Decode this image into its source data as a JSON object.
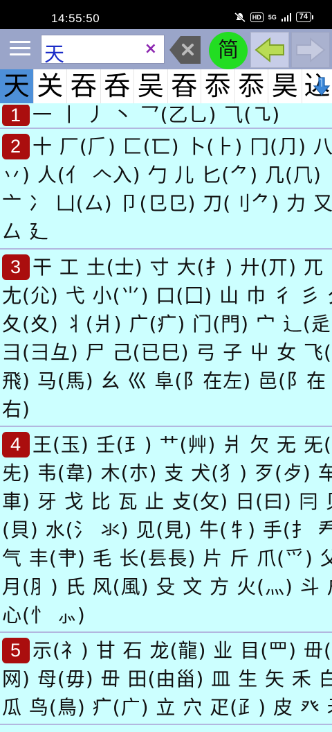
{
  "status_bar": {
    "time": "14:55:50",
    "hd": "HD",
    "network": "5G",
    "battery": "74"
  },
  "toolbar": {
    "search_value": "天",
    "clear_label": "×",
    "simplified_label": "简"
  },
  "candidates": {
    "items": [
      "天",
      "关",
      "吞",
      "呑",
      "吴",
      "昋",
      "忝",
      "忝",
      "昊"
    ],
    "partial": "込"
  },
  "sections": [
    {
      "number": "1",
      "lines": [
        "一 丨 丿 丶 乛(乙乚) ⺄(㇈)"
      ]
    },
    {
      "number": "2",
      "lines": [
        "十 厂(𠂆) 匚(匸) 卜(⺊) 冂(⺆) 八(",
        "丷) 人(亻 𠆢入) 勹 儿 匕(⺈) 几(⺇)",
        "亠 冫 凵(厶) 卩(⺋㔾) 刀(刂⺈) 力 又",
        "厶 廴"
      ]
    },
    {
      "number": "3",
      "lines": [
        "干 工 土(士) 寸 大(⺘) 廾(丌) 兀",
        "尢(尣) 弋 小(⺌) 口(囗) 山 巾 彳 彡 夕",
        "夂(夊) 丬(爿) 广(疒) 门(門) 宀 辶(辵)",
        "彐(⺕彑) 尸 己(已巳) 弓 子 屮 女 飞(",
        "飛) 马(馬) 幺 巛 阜(阝在左) 邑(阝在",
        "右)"
      ]
    },
    {
      "number": "4",
      "lines": [
        "王(玉) 壬(⺩) 艹(艸) 爿 欠 无 旡(",
        "兂) 韦(韋) 木(朩) 支 犬(犭) 歹(歺) 车(",
        "車) 牙 戈 比 瓦 止 攴(攵) 日(曰) 冃 贝",
        "(貝) 水(氵 氺) 见(見) 牛(牜) 手(扌 龵)",
        "气 丰(⺺) 毛 长(镸長) 片 斤 爪(⺤) 父",
        "月(⺼) 氏 风(風) 殳 文 方 火(灬) 斗 户",
        "心(忄 ⺗)"
      ]
    },
    {
      "number": "5",
      "lines": [
        "示(礻) 甘 石 龙(龍) 业 目(罒) 毌(",
        "网) 母(毋) 毌 田(由甾) 皿 生 矢 禾 白",
        "瓜 鸟(鳥) 疒(广) 立 穴 疋(⺪) 皮 癶 矛"
      ]
    }
  ]
}
